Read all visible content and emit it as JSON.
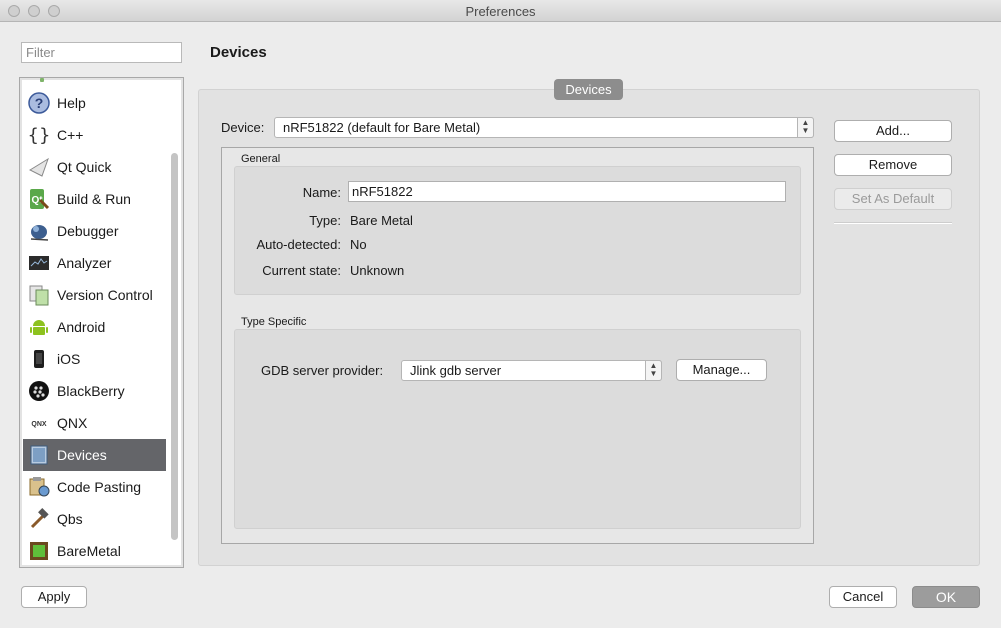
{
  "window": {
    "title": "Preferences"
  },
  "filter": {
    "placeholder": "Filter"
  },
  "categories": [
    {
      "label": "Help",
      "icon": "help-icon"
    },
    {
      "label": "C++",
      "icon": "cpp-braces-icon"
    },
    {
      "label": "Qt Quick",
      "icon": "qt-quick-icon"
    },
    {
      "label": "Build & Run",
      "icon": "build-run-icon"
    },
    {
      "label": "Debugger",
      "icon": "debugger-bug-icon"
    },
    {
      "label": "Analyzer",
      "icon": "analyzer-icon"
    },
    {
      "label": "Version Control",
      "icon": "version-control-icon"
    },
    {
      "label": "Android",
      "icon": "android-icon"
    },
    {
      "label": "iOS",
      "icon": "ios-device-icon"
    },
    {
      "label": "BlackBerry",
      "icon": "blackberry-icon"
    },
    {
      "label": "QNX",
      "icon": "qnx-icon"
    },
    {
      "label": "Devices",
      "icon": "devices-icon"
    },
    {
      "label": "Code Pasting",
      "icon": "code-pasting-icon"
    },
    {
      "label": "Qbs",
      "icon": "qbs-hammer-icon"
    },
    {
      "label": "BareMetal",
      "icon": "baremetal-chip-icon"
    }
  ],
  "selected_category": "Devices",
  "page": {
    "title": "Devices",
    "tab": "Devices"
  },
  "device": {
    "label": "Device:",
    "selected": "nRF51822 (default for Bare Metal)"
  },
  "side_buttons": {
    "add": "Add...",
    "remove": "Remove",
    "set_default": "Set As Default"
  },
  "general": {
    "title": "General",
    "name_label": "Name:",
    "name_value": "nRF51822",
    "type_label": "Type:",
    "type_value": "Bare Metal",
    "auto_label": "Auto-detected:",
    "auto_value": "No",
    "state_label": "Current state:",
    "state_value": "Unknown"
  },
  "type_specific": {
    "title": "Type Specific",
    "gdb_label": "GDB server provider:",
    "gdb_value": "Jlink gdb server",
    "manage": "Manage..."
  },
  "footer": {
    "apply": "Apply",
    "cancel": "Cancel",
    "ok": "OK"
  }
}
